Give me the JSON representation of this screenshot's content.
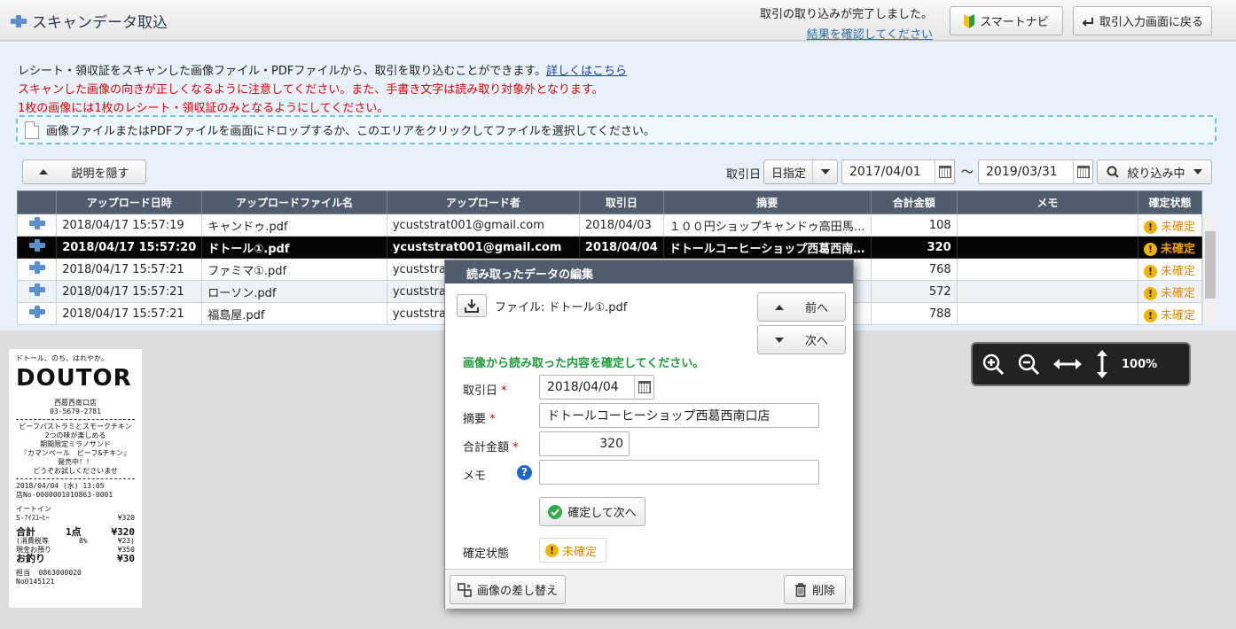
{
  "header": {
    "title": "スキャンデータ取込",
    "notice_line1": "取引の取り込みが完了しました。",
    "notice_line2": "結果を確認してください",
    "smart_navi": "スマートナビ",
    "back_button": "取引入力画面に戻る"
  },
  "description": {
    "line1": "レシート・領収証をスキャンした画像ファイル・PDFファイルから、取引を取り込むことができます。",
    "line1_link": "詳しくはこちら",
    "line2": "スキャンした画像の向きが正しくなるように注意してください。また、手書き文字は読み取り対象外となります。",
    "line3": "1枚の画像には1枚のレシート・領収証のみとなるようにしてください。",
    "dropzone": "画像ファイルまたはPDFファイルを画面にドロップするか、このエリアをクリックしてファイルを選択してください。"
  },
  "toolbar": {
    "hide_desc": "説明を隠す",
    "date_label": "取引日",
    "date_mode": "日指定",
    "date_from": "2017/04/01",
    "tilde": "～",
    "date_to": "2019/03/31",
    "filter": "絞り込み中"
  },
  "table": {
    "headers": [
      "",
      "アップロード日時",
      "アップロードファイル名",
      "アップロード者",
      "取引日",
      "摘要",
      "合計金額",
      "メモ",
      "確定状態"
    ],
    "rows": [
      {
        "datetime": "2018/04/17 15:57:19",
        "file": "キャンドゥ.pdf",
        "uploader": "ycuststrat001@gmail.com",
        "date": "2018/04/03",
        "summary": "１００円ショップキャンドゥ高田馬…",
        "amount": "108",
        "memo": "",
        "status": "未確定"
      },
      {
        "datetime": "2018/04/17 15:57:20",
        "file": "ドトール①.pdf",
        "uploader": "ycuststrat001@gmail.com",
        "date": "2018/04/04",
        "summary": "ドトールコーヒーショップ西葛西南…",
        "amount": "320",
        "memo": "",
        "status": "未確定"
      },
      {
        "datetime": "2018/04/17 15:57:21",
        "file": "ファミマ①.pdf",
        "uploader": "ycuststrat",
        "date": "",
        "summary": "",
        "amount": "768",
        "memo": "",
        "status": "未確定"
      },
      {
        "datetime": "2018/04/17 15:57:21",
        "file": "ローソン.pdf",
        "uploader": "ycuststrat",
        "date": "",
        "summary": "",
        "amount": "572",
        "memo": "",
        "status": "未確定"
      },
      {
        "datetime": "2018/04/17 15:57:21",
        "file": "福島屋.pdf",
        "uploader": "ycuststrat",
        "date": "",
        "summary": "",
        "amount": "788",
        "memo": "",
        "status": "未確定"
      }
    ]
  },
  "receipt": {
    "slogan": "ドトール、のち、はれやか。",
    "logo": "DOUTOR",
    "store": "西葛西南口店",
    "phone": "03-5679-2781",
    "promo1": "ビーフパストラミとスモークチキン",
    "promo2": "2つの味が楽しめる",
    "promo3": "期間限定ミラノサンド",
    "promo4": "『カマンベール　ビーフ&チキン』",
    "promo5": "発売中！！",
    "promo6": "どうぞお試しくださいませ",
    "datetime": "2018/04/04 (水) 13:05",
    "receipt_no": "店No-0000001010863-0001",
    "eat_in": "イートイン",
    "item": "S-ｱｲｽｺｰﾋｰ",
    "item_price": "¥320",
    "total_label": "合計",
    "qty": "1点",
    "total": "¥320",
    "tax_label": "(消費税等",
    "tax_rate": "8%",
    "tax": "¥23)",
    "cash_label": "現金お預り",
    "cash": "¥350",
    "change_label": "お釣り",
    "change": "¥30",
    "staff_label": "担当",
    "staff": "0863000020",
    "no": "No0145121"
  },
  "zoom": {
    "level": "100%"
  },
  "modal": {
    "title": "読み取ったデータの編集",
    "file_label": "ファイル: ドトール①.pdf",
    "prev": "前へ",
    "next": "次へ",
    "instruction": "画像から読み取った内容を確定してください。",
    "date_label": "取引日",
    "date_value": "2018/04/04",
    "summary_label": "摘要",
    "summary_value": "ドトールコーヒーショップ西葛西南口店",
    "amount_label": "合計金額",
    "amount_value": "320",
    "memo_label": "メモ",
    "memo_value": "",
    "required_mark": "*",
    "confirm_next": "確定して次へ",
    "status_label": "確定状態",
    "status_value": "未確定",
    "replace_image": "画像の差し替え",
    "delete": "削除"
  }
}
